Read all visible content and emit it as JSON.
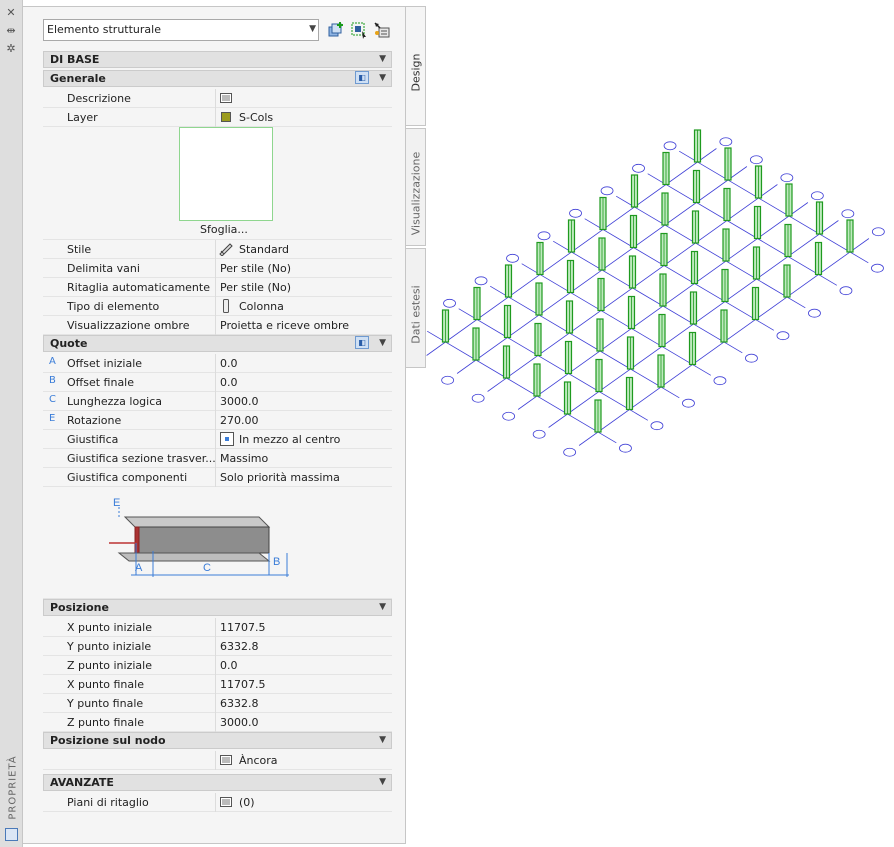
{
  "side": {
    "title": "PROPRIETÀ"
  },
  "selector": {
    "value": "Elemento strutturale"
  },
  "tabs": {
    "design": "Design",
    "visualizzazione": "Visualizzazione",
    "dati_estesi": "Dati estesi"
  },
  "sections": {
    "di_base": "DI BASE",
    "generale": "Generale",
    "quote": "Quote",
    "posizione": "Posizione",
    "posizione_nodo": "Posizione sul nodo",
    "avanzate": "AVANZATE"
  },
  "generale": {
    "descrizione_label": "Descrizione",
    "layer_label": "Layer",
    "layer_value": "S-Cols",
    "layer_color": "#9b9b1e",
    "browse_label": "Sfoglia...",
    "stile_label": "Stile",
    "stile_value": "Standard",
    "delimita_label": "Delimita vani",
    "delimita_value": "Per stile (No)",
    "ritaglia_label": "Ritaglia automaticamente",
    "ritaglia_value": "Per stile (No)",
    "tipo_label": "Tipo di elemento",
    "tipo_value": "Colonna",
    "ombre_label": "Visualizzazione ombre",
    "ombre_value": "Proietta e riceve ombre"
  },
  "quote": {
    "offset_iniziale": {
      "ind": "A",
      "label": "Offset iniziale",
      "value": "0.0"
    },
    "offset_finale": {
      "ind": "B",
      "label": "Offset finale",
      "value": "0.0"
    },
    "lunghezza": {
      "ind": "C",
      "label": "Lunghezza logica",
      "value": "3000.0"
    },
    "rotazione": {
      "ind": "E",
      "label": "Rotazione",
      "value": "270.00"
    },
    "giustifica": {
      "label": "Giustifica",
      "value": "In mezzo al centro"
    },
    "giustifica_sezione": {
      "label": "Giustifica  sezione  trasver...",
      "value": "Massimo"
    },
    "giustifica_componenti": {
      "label": "Giustifica componenti",
      "value": "Solo priorità massima"
    },
    "diagram": {
      "e": "E",
      "a": "A",
      "c": "C",
      "b": "B"
    }
  },
  "posizione": {
    "x_iniziale": {
      "label": "X punto iniziale",
      "value": "11707.5"
    },
    "y_iniziale": {
      "label": "Y punto iniziale",
      "value": "6332.8"
    },
    "z_iniziale": {
      "label": "Z punto iniziale",
      "value": "0.0"
    },
    "x_finale": {
      "label": "X punto finale",
      "value": "11707.5"
    },
    "y_finale": {
      "label": "Y punto finale",
      "value": "6332.8"
    },
    "z_finale": {
      "label": "Z punto finale",
      "value": "3000.0"
    }
  },
  "nodo": {
    "value": "Àncora"
  },
  "avanzate": {
    "piani_label": "Piani di ritaglio",
    "piani_value": "(0)"
  },
  "colors": {
    "grid": "#3f3fd6",
    "column": "#1f9a1f",
    "bubble": "#3f3fd6"
  }
}
